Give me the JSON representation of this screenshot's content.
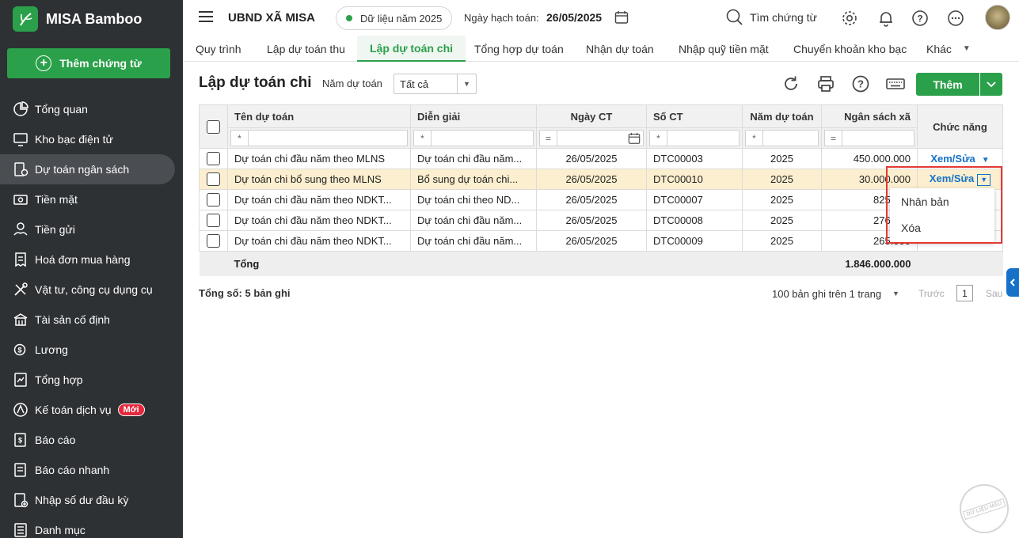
{
  "app": {
    "name": "MISA Bamboo",
    "add_voucher": "Thêm chứng từ"
  },
  "sidebar": {
    "items": [
      {
        "label": "Tổng quan",
        "icon": "dashboard-icon"
      },
      {
        "label": "Kho bạc điện tử",
        "icon": "monitor-icon"
      },
      {
        "label": "Dự toán ngân sách",
        "icon": "budget-icon",
        "active": true
      },
      {
        "label": "Tiền mặt",
        "icon": "cash-icon"
      },
      {
        "label": "Tiền gửi",
        "icon": "deposit-icon"
      },
      {
        "label": "Hoá đơn mua hàng",
        "icon": "invoice-icon"
      },
      {
        "label": "Vật tư, công cụ dụng cụ",
        "icon": "tools-icon"
      },
      {
        "label": "Tài sản cố định",
        "icon": "asset-icon"
      },
      {
        "label": "Lương",
        "icon": "salary-icon"
      },
      {
        "label": "Tổng hợp",
        "icon": "summary-icon"
      },
      {
        "label": "Kế toán dịch vụ",
        "icon": "service-icon",
        "badge": "Mới"
      },
      {
        "label": "Báo cáo",
        "icon": "report-icon"
      },
      {
        "label": "Báo cáo nhanh",
        "icon": "quick-report-icon"
      },
      {
        "label": "Nhập số dư đầu kỳ",
        "icon": "opening-balance-icon"
      },
      {
        "label": "Danh mục",
        "icon": "catalog-icon"
      }
    ]
  },
  "topbar": {
    "org": "UBND XÃ MISA",
    "data_year": "Dữ liệu năm 2025",
    "posting_date_label": "Ngày hạch toán:",
    "posting_date": "26/05/2025",
    "search": "Tìm chứng từ"
  },
  "tabs": [
    "Quy trình",
    "Lập dự toán thu",
    "Lập dự toán chi",
    "Tổng hợp dự toán",
    "Nhận dự toán",
    "Nhập quỹ tiền mặt",
    "Chuyển khoản kho bạc",
    "Khác"
  ],
  "page": {
    "title": "Lập dự toán chi",
    "year_label": "Năm dự toán",
    "year_value": "Tất cả",
    "add_label": "Thêm"
  },
  "table": {
    "headers": [
      "Tên dự toán",
      "Diễn giải",
      "Ngày CT",
      "Số CT",
      "Năm dự toán",
      "Ngân sách xã",
      "Chức năng"
    ],
    "filter_ops": [
      "*",
      "*",
      "=",
      "*",
      "*",
      "="
    ],
    "rows": [
      {
        "name": "Dự toán chi đầu năm theo MLNS",
        "desc": "Dự toán chi đầu năm...",
        "date": "26/05/2025",
        "no": "DTC00003",
        "year": "2025",
        "amount": "450.000.000",
        "action": "Xem/Sửa"
      },
      {
        "name": "Dự toán chi bổ sung theo MLNS",
        "desc": "Bổ sung dự toán chi...",
        "date": "26/05/2025",
        "no": "DTC00010",
        "year": "2025",
        "amount": "30.000.000",
        "action": "Xem/Sửa"
      },
      {
        "name": "Dự toán chi đầu năm theo NDKT...",
        "desc": "Dự toán chi theo ND...",
        "date": "26/05/2025",
        "no": "DTC00007",
        "year": "2025",
        "amount": "825.000",
        "action": ""
      },
      {
        "name": "Dự toán chi đầu năm theo NDKT...",
        "desc": "Dự toán chi đầu năm...",
        "date": "26/05/2025",
        "no": "DTC00008",
        "year": "2025",
        "amount": "276.000",
        "action": ""
      },
      {
        "name": "Dự toán chi đầu năm theo NDKT...",
        "desc": "Dự toán chi đầu năm...",
        "date": "26/05/2025",
        "no": "DTC00009",
        "year": "2025",
        "amount": "265.000",
        "action": ""
      }
    ],
    "total_label": "Tổng",
    "total_amount": "1.846.000.000"
  },
  "menu": {
    "items": [
      "Nhân bản",
      "Xóa"
    ]
  },
  "footer": {
    "count": "Tổng số: 5 bản ghi",
    "paging": "100 bản ghi trên 1 trang",
    "prev": "Trước",
    "page": "1",
    "next": "Sau"
  },
  "stamp": "DỮ LIỆU MẪU",
  "colors": {
    "brand": "#2ba04a",
    "sidebar": "#2e3134",
    "link": "#1572c8",
    "selected_row": "#fcefcf",
    "highlight": "#e53935"
  }
}
